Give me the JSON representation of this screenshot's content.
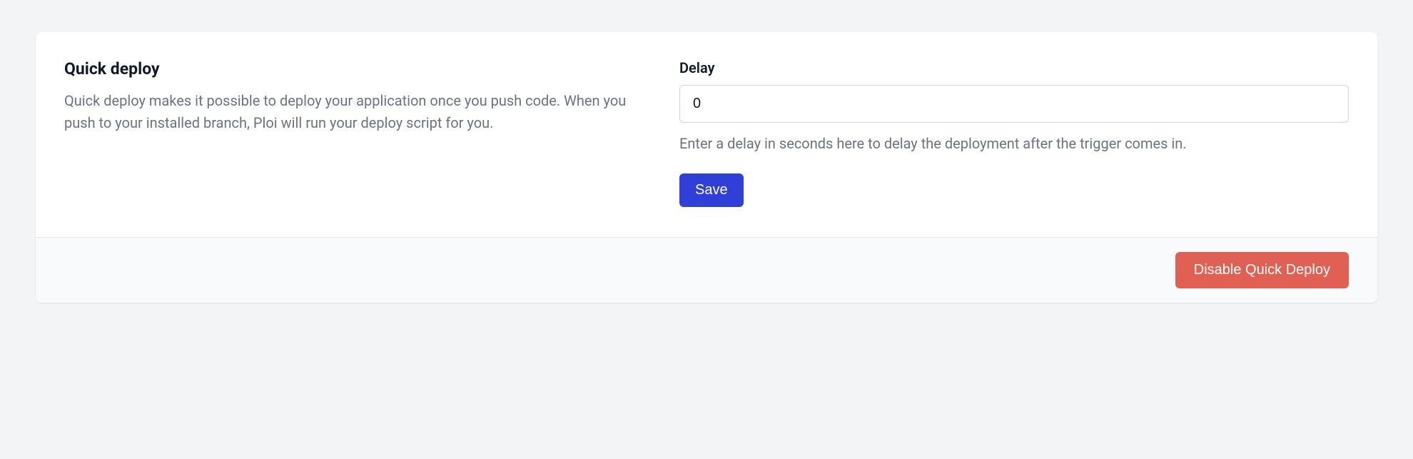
{
  "quick_deploy": {
    "title": "Quick deploy",
    "description": "Quick deploy makes it possible to deploy your application once you push code. When you push to your installed branch, Ploi will run your deploy script for you.",
    "delay": {
      "label": "Delay",
      "value": "0",
      "help": "Enter a delay in seconds here to delay the deployment after the trigger comes in."
    },
    "save_label": "Save",
    "disable_label": "Disable Quick Deploy"
  }
}
